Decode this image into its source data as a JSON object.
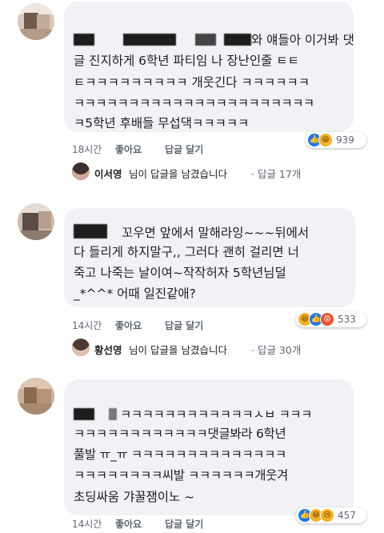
{
  "comments": [
    {
      "lines": [
        "와 얘들아 이거봐 댓",
        "글 진지하게 6학년 파티임 나 장난인줄 ㅌㅌ",
        "ㅌㅋㅋㅋㅋㅋㅋㅋㅋㅋ 개웃긴다 ㅋㅋㅋㅋㅋㅋ",
        "ㅋㅋㅋㅋㅋㅋㅋㅋㅋㅋㅋㅋㅋㅋㅋㅋㅋㅋㅋㅋㅋㅋ",
        "ㅋ5학년 후배들 무섭댁ㅋㅋㅋㅋㅋ"
      ],
      "time": "18시간",
      "like": "좋아요",
      "reply_label": "답글 달기",
      "reaction_count": "939",
      "reaction_icons": [
        "like-reaction-icon",
        "haha-reaction-icon"
      ],
      "reply": {
        "name": "이서영",
        "text": "님이 답글을 남겼습니다",
        "count": "· 답글 17개"
      }
    },
    {
      "lines": [
        "꼬우면 앞에서 말해라잉~~~뒤에서",
        "다 들리게 하지말구,, 그러다 괜히 걸리면 너",
        "죽고 나죽는 날이여~작작허자 5학년님덜",
        "_*^^* 어때 일진같애?"
      ],
      "time": "14시간",
      "like": "좋아요",
      "reply_label": "답글 달기",
      "reaction_count": "533",
      "reaction_icons": [
        "haha-reaction-icon",
        "like-reaction-icon",
        "angry-reaction-icon"
      ],
      "reply": {
        "name": "황선영",
        "text": "님이 답글을 남겼습니다",
        "count": "· 답글 30개"
      }
    },
    {
      "lines": [
        "ㅋㅋㅋㅋㅋㅋㅋㅋㅋㅋㅋㅋㅅㅂ ㅋㅋㅋ",
        "ㅋㅋㅋㅋㅋㅋㅋㅋㅋㅋㅋㅋ댓글봐라 6학년",
        "풀발 ㅠ_ㅠ ㅋㅋㅋㅋㅋㅋㅋㅋㅋㅋㅋㅋㅋㅋ",
        "ㅋㅋㅋㅋㅋㅋㅋㅋ씨발 ㅋㅋㅋㅋㅋㅋ개웃겨",
        "초딩싸움 갸꿀잼이노 ~"
      ],
      "time": "14시간",
      "like": "좋아요",
      "reply_label": "답글 달기",
      "reaction_count": "457",
      "reaction_icons": [
        "like-reaction-icon",
        "haha-reaction-icon",
        "sad-reaction-icon"
      ]
    }
  ],
  "colors": {
    "bubble": "#f0f2f5",
    "like_blue": "#1877f2",
    "haha_yellow": "#f7b125",
    "angry_orange": "#e8552c",
    "meta_gray": "#606770"
  }
}
